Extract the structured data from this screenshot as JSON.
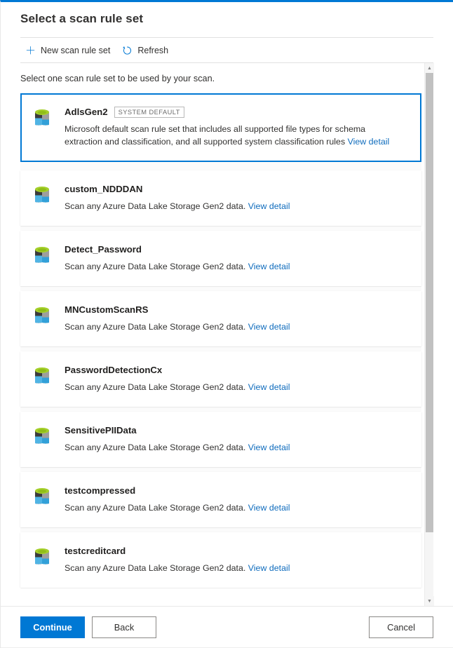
{
  "panel": {
    "title": "Select a scan rule set",
    "intro": "Select one scan rule set to be used by your scan."
  },
  "commandbar": {
    "new_label": "New scan rule set",
    "new_icon": "plus-icon",
    "refresh_label": "Refresh",
    "refresh_icon": "refresh-icon"
  },
  "colors": {
    "accent": "#0078d4",
    "link": "#0f6cbd",
    "icon_green": "#a4cf2a",
    "icon_blue_light": "#50b4e4",
    "icon_blue_dark": "#32a0d8",
    "icon_gray_dark": "#3b3b3b",
    "icon_gray_light": "#9e9e9e"
  },
  "rule_sets": [
    {
      "name": "AdlsGen2",
      "badge": "SYSTEM DEFAULT",
      "description": "Microsoft default scan rule set that includes all supported file types for schema extraction and classification, and all supported system classification rules",
      "link": "View detail",
      "selected": true
    },
    {
      "name": "custom_NDDDAN",
      "badge": "",
      "description": "Scan any Azure Data Lake Storage Gen2 data.",
      "link": "View detail",
      "selected": false
    },
    {
      "name": "Detect_Password",
      "badge": "",
      "description": "Scan any Azure Data Lake Storage Gen2 data.",
      "link": "View detail",
      "selected": false
    },
    {
      "name": "MNCustomScanRS",
      "badge": "",
      "description": "Scan any Azure Data Lake Storage Gen2 data.",
      "link": "View detail",
      "selected": false
    },
    {
      "name": "PasswordDetectionCx",
      "badge": "",
      "description": "Scan any Azure Data Lake Storage Gen2 data.",
      "link": "View detail",
      "selected": false
    },
    {
      "name": "SensitivePIIData",
      "badge": "",
      "description": "Scan any Azure Data Lake Storage Gen2 data.",
      "link": "View detail",
      "selected": false
    },
    {
      "name": "testcompressed",
      "badge": "",
      "description": "Scan any Azure Data Lake Storage Gen2 data.",
      "link": "View detail",
      "selected": false
    },
    {
      "name": "testcreditcard",
      "badge": "",
      "description": "Scan any Azure Data Lake Storage Gen2 data.",
      "link": "View detail",
      "selected": false
    }
  ],
  "footer": {
    "continue_label": "Continue",
    "back_label": "Back",
    "cancel_label": "Cancel"
  },
  "scrollbar": {
    "up_arrow": "▲",
    "down_arrow": "▼"
  }
}
